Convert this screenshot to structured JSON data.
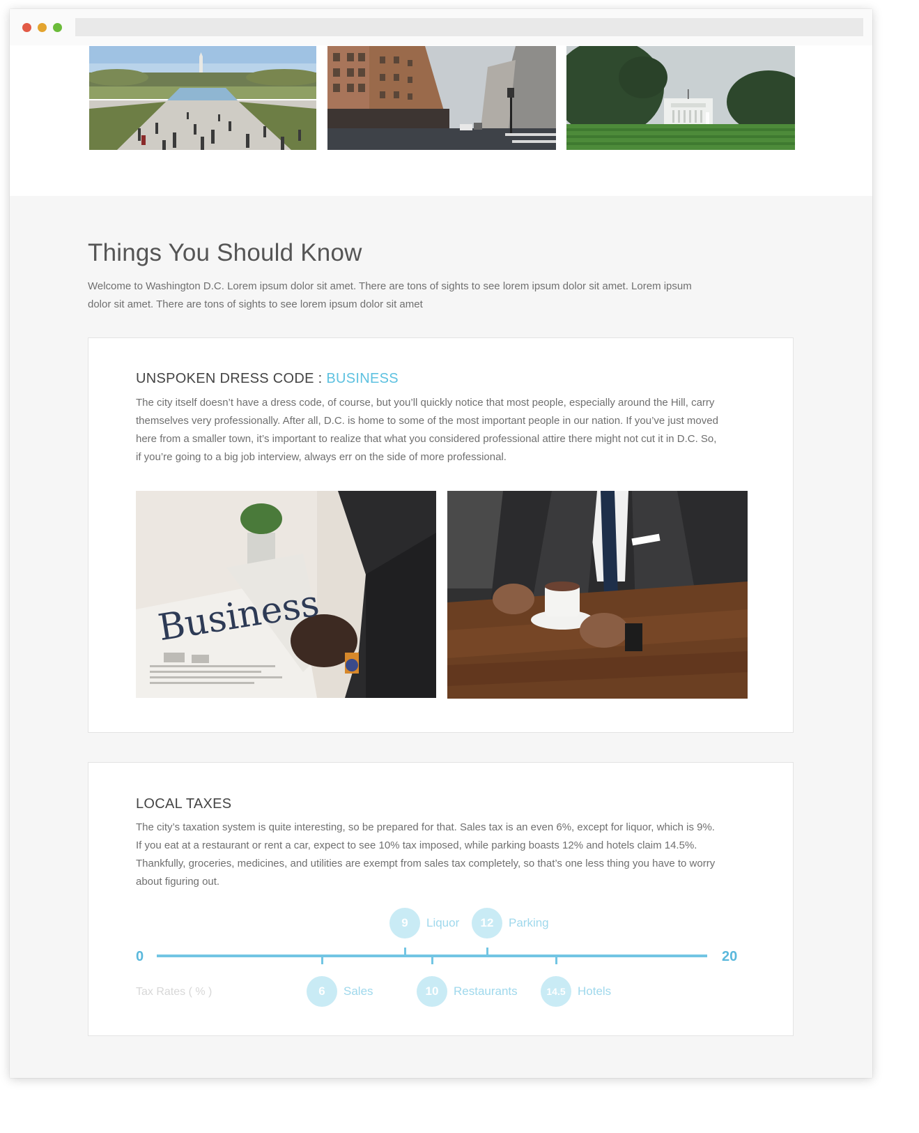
{
  "section": {
    "title": "Things You Should Know",
    "intro": "Welcome to Washington D.C. Lorem ipsum dolor sit amet. There are tons of sights to see lorem ipsum dolor sit amet. Lorem ipsum dolor sit amet. There are tons of sights to see lorem ipsum dolor sit amet"
  },
  "dress_code": {
    "title_prefix": "UNSPOKEN DRESS CODE : ",
    "title_accent": "BUSINESS",
    "body": "The city itself doesn’t have a dress code, of course, but you’ll quickly notice that most people, especially around the Hill, carry themselves very professionally. After all, D.C. is home to some of the most important people in our nation. If you’ve just moved here from a smaller town, it’s important to realize that what you considered professional attire there might not cut it in D.C. So, if you’re going to a big job interview, always err on the side of more professional.",
    "newspaper_headline": "Business"
  },
  "taxes": {
    "title": "LOCAL TAXES",
    "body": "The city’s taxation system is quite interesting, so be prepared for that. Sales tax is an even 6%, except for liquor, which is 9%. If you eat at a restaurant or rent a car, expect to see 10% tax imposed, while parking boasts 12% and hotels claim 14.5%. Thankfully, groceries, medicines, and utilities are exempt from sales tax completely, so that’s one less thing you have to worry about figuring out.",
    "axis_min_label": "0",
    "axis_max_label": "20",
    "axis_caption": "Tax Rates ( % )"
  },
  "chart_data": {
    "type": "scatter",
    "xlim": [
      0,
      20
    ],
    "xlabel": "Tax Rates ( % )",
    "points": [
      {
        "label": "Sales",
        "value": 6,
        "display": "6",
        "side": "below"
      },
      {
        "label": "Liquor",
        "value": 9,
        "display": "9",
        "side": "above"
      },
      {
        "label": "Restaurants",
        "value": 10,
        "display": "10",
        "side": "below"
      },
      {
        "label": "Parking",
        "value": 12,
        "display": "12",
        "side": "above"
      },
      {
        "label": "Hotels",
        "value": 14.5,
        "display": "14.5",
        "side": "below"
      }
    ],
    "color": "#72c5e3"
  },
  "colors": {
    "accent": "#5dc1e0",
    "marker_fill": "#c9ebf5",
    "axis": "#72c5e3"
  }
}
